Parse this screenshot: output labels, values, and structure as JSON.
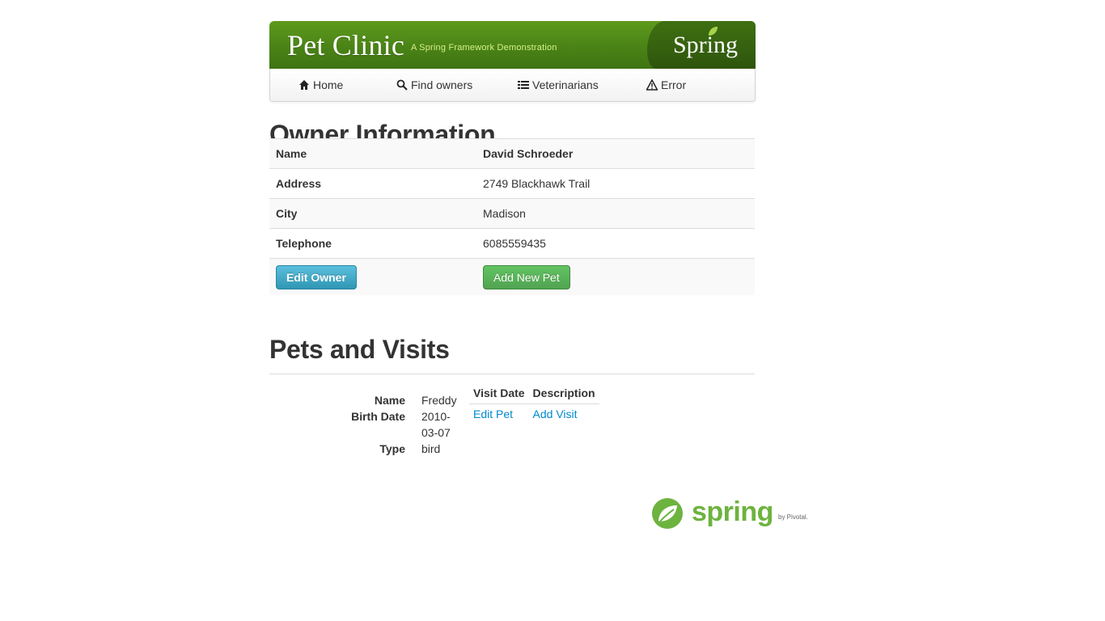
{
  "header": {
    "title": "Pet Clinic",
    "tagline": "A Spring Framework Demonstration",
    "brand": "Spring"
  },
  "nav": [
    {
      "label": "Home",
      "icon": "home-icon"
    },
    {
      "label": "Find owners",
      "icon": "search-icon"
    },
    {
      "label": "Veterinarians",
      "icon": "list-icon"
    },
    {
      "label": "Error",
      "icon": "warning-icon"
    }
  ],
  "owner": {
    "heading": "Owner Information",
    "rows": [
      {
        "label": "Name",
        "value": "David Schroeder"
      },
      {
        "label": "Address",
        "value": "2749 Blackhawk Trail"
      },
      {
        "label": "City",
        "value": "Madison"
      },
      {
        "label": "Telephone",
        "value": "6085559435"
      }
    ],
    "edit_button": "Edit Owner",
    "add_pet_button": "Add New Pet"
  },
  "pets": {
    "heading": "Pets and Visits",
    "items": [
      {
        "name_label": "Name",
        "name": "Freddy",
        "birth_label": "Birth Date",
        "birth_date_line1": "2010-",
        "birth_date_line2": "03-07",
        "type_label": "Type",
        "type": "bird",
        "visit_date_header": "Visit Date",
        "description_header": "Description",
        "edit_pet_link": "Edit Pet",
        "add_visit_link": "Add Visit"
      }
    ]
  },
  "footer": {
    "logo_word": "spring",
    "logo_by": "by Pivotal."
  },
  "colors": {
    "brand_green": "#4a8316",
    "spring_green": "#6db33f",
    "link_blue": "#0088cc",
    "info_button": "#2f96b4",
    "success_button": "#51a351"
  }
}
